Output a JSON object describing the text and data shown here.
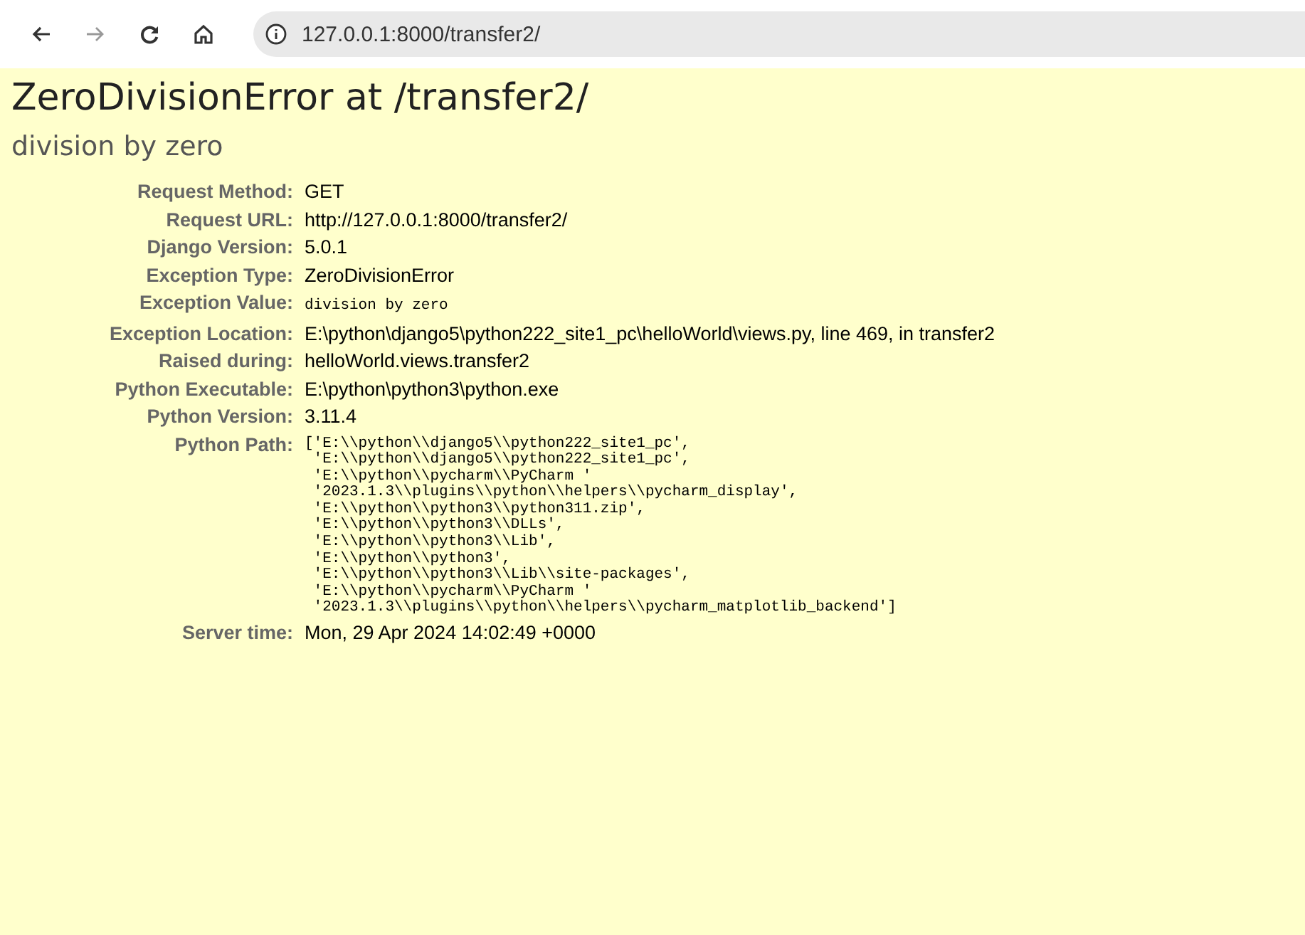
{
  "toolbar": {
    "url": "127.0.0.1:8000/transfer2/"
  },
  "title": "ZeroDivisionError at /transfer2/",
  "subtitle": "division by zero",
  "meta": [
    {
      "label": "Request Method:",
      "kind": "text",
      "value": "GET"
    },
    {
      "label": "Request URL:",
      "kind": "text",
      "value": "http://127.0.0.1:8000/transfer2/"
    },
    {
      "label": "Django Version:",
      "kind": "text",
      "value": "5.0.1"
    },
    {
      "label": "Exception Type:",
      "kind": "text",
      "value": "ZeroDivisionError"
    },
    {
      "label": "Exception Value:",
      "kind": "code",
      "value": "division by zero"
    },
    {
      "label": "Exception Location:",
      "kind": "text",
      "value": "E:\\python\\django5\\python222_site1_pc\\helloWorld\\views.py, line 469, in transfer2"
    },
    {
      "label": "Raised during:",
      "kind": "text",
      "value": "helloWorld.views.transfer2"
    },
    {
      "label": "Python Executable:",
      "kind": "text",
      "value": "E:\\python\\python3\\python.exe"
    },
    {
      "label": "Python Version:",
      "kind": "text",
      "value": "3.11.4"
    },
    {
      "label": "Python Path:",
      "kind": "lines",
      "lines": [
        "['E:\\\\python\\\\django5\\\\python222_site1_pc',",
        " 'E:\\\\python\\\\django5\\\\python222_site1_pc',",
        " 'E:\\\\python\\\\pycharm\\\\PyCharm '",
        " '2023.1.3\\\\plugins\\\\python\\\\helpers\\\\pycharm_display',",
        " 'E:\\\\python\\\\python3\\\\python311.zip',",
        " 'E:\\\\python\\\\python3\\\\DLLs',",
        " 'E:\\\\python\\\\python3\\\\Lib',",
        " 'E:\\\\python\\\\python3',",
        " 'E:\\\\python\\\\python3\\\\Lib\\\\site-packages',",
        " 'E:\\\\python\\\\pycharm\\\\PyCharm '",
        " '2023.1.3\\\\plugins\\\\python\\\\helpers\\\\pycharm_matplotlib_backend']"
      ]
    },
    {
      "label": "Server time:",
      "kind": "text",
      "value": "Mon, 29 Apr 2024 14:02:49 +0000"
    }
  ]
}
